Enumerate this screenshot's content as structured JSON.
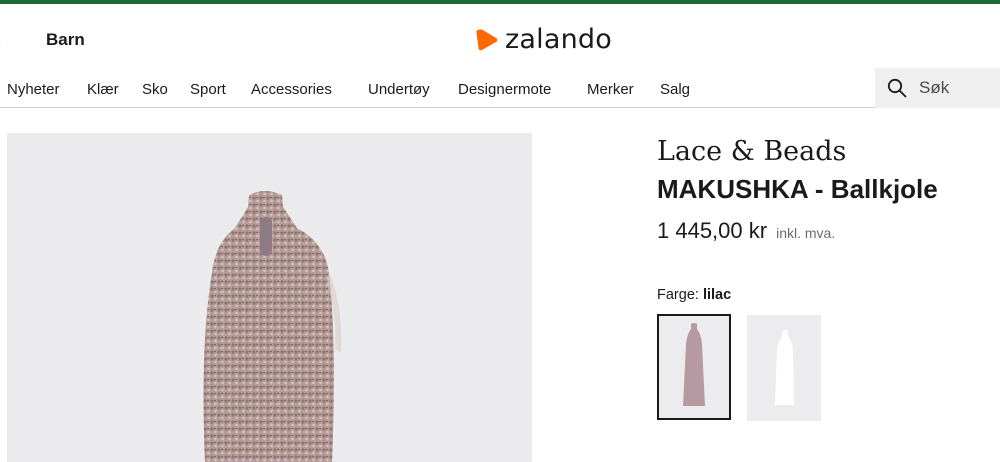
{
  "header": {
    "gender_links": [
      "rre",
      "Barn"
    ],
    "logo_text": "zalando",
    "brand_color": "#ff6900"
  },
  "category_nav": [
    "Nyheter",
    "Klær",
    "Sko",
    "Sport",
    "Accessories",
    "Undertøy",
    "Designermote",
    "Merker",
    "Salg"
  ],
  "search": {
    "placeholder": "Søk",
    "icon": "search-icon"
  },
  "product": {
    "brand": "Lace & Beads",
    "name": "MAKUSHKA - Ballkjole",
    "price": "1 445,00 kr",
    "vat_note": "inkl. mva.",
    "color_label": "Farge:",
    "color_value": "lilac",
    "swatches": [
      {
        "name": "lilac",
        "selected": true
      },
      {
        "name": "white",
        "selected": false
      }
    ]
  },
  "colors": {
    "top_bar": "#1e6b32",
    "dress_lilac": "#b89aa3",
    "gallery_bg": "#ebebed"
  }
}
